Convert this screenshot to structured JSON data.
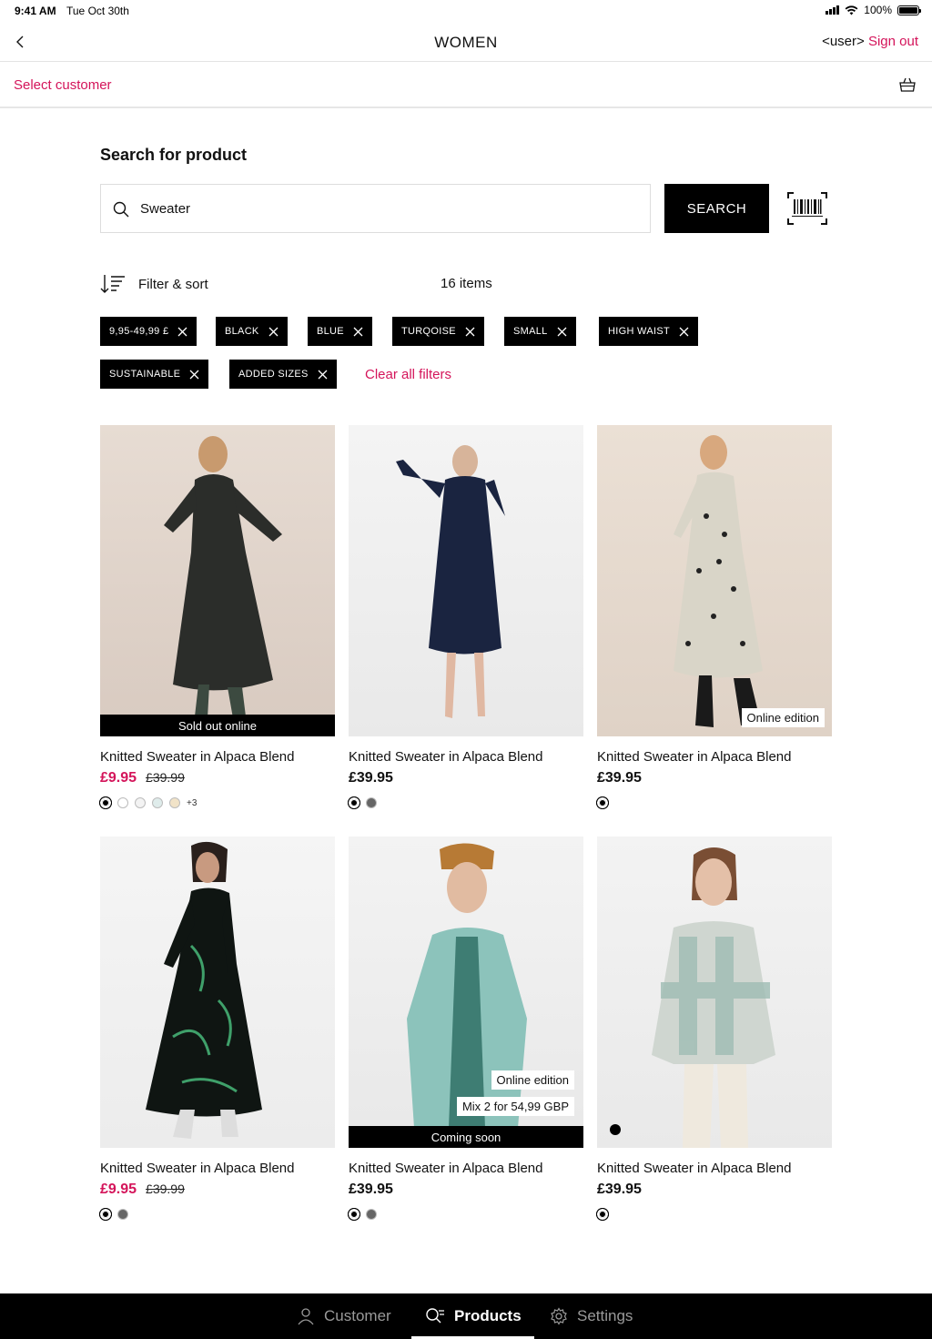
{
  "status_bar": {
    "time": "9:41 AM",
    "date": "Tue Oct 30th",
    "battery": "100%"
  },
  "header": {
    "title": "WOMEN",
    "user": "<user>",
    "sign_out": "Sign out"
  },
  "customer_bar": {
    "select_customer": "Select customer"
  },
  "search": {
    "heading": "Search for product",
    "value": "Sweater",
    "button": "SEARCH"
  },
  "toolbar": {
    "filter_sort": "Filter & sort",
    "items_count": "16 items"
  },
  "filters": [
    "9,95-49,99 £",
    "BLACK",
    "BLUE",
    "TURQOISE",
    "SMALL",
    "HIGH WAIST",
    "SUSTAINABLE",
    "ADDED SIZES"
  ],
  "clear_filters": "Clear all filters",
  "products": [
    {
      "name": "Knitted Sweater in Alpaca Blend",
      "price": "£9.95",
      "was": "£39.99",
      "badge": "Sold out online",
      "more_colors": "+3",
      "swatches": [
        "#000000",
        "#ffffff",
        "#f3f3f3",
        "#dfeceb",
        "#f1e3c8"
      ]
    },
    {
      "name": "Knitted Sweater in Alpaca Blend",
      "price": "£39.95",
      "swatches": [
        "#000000",
        "#666666"
      ]
    },
    {
      "name": "Knitted Sweater in Alpaca Blend",
      "price": "£39.95",
      "tag": "Online edition",
      "swatches": [
        "#000000"
      ]
    },
    {
      "name": "Knitted Sweater in Alpaca Blend",
      "price": "£9.95",
      "was": "£39.99",
      "swatches": [
        "#000000",
        "#666666"
      ]
    },
    {
      "name": "Knitted Sweater in Alpaca Blend",
      "price": "£39.95",
      "tag": "Online edition",
      "tag2": "Mix 2 for 54,99 GBP",
      "badge": "Coming soon",
      "swatches": [
        "#000000",
        "#666666"
      ]
    },
    {
      "name": "Knitted Sweater in Alpaca Blend",
      "price": "£39.95",
      "swatches": [
        "#000000"
      ]
    }
  ],
  "tab_bar": {
    "customer": "Customer",
    "products": "Products",
    "settings": "Settings"
  },
  "colors": {
    "accent": "#d4145a",
    "black": "#000000"
  }
}
